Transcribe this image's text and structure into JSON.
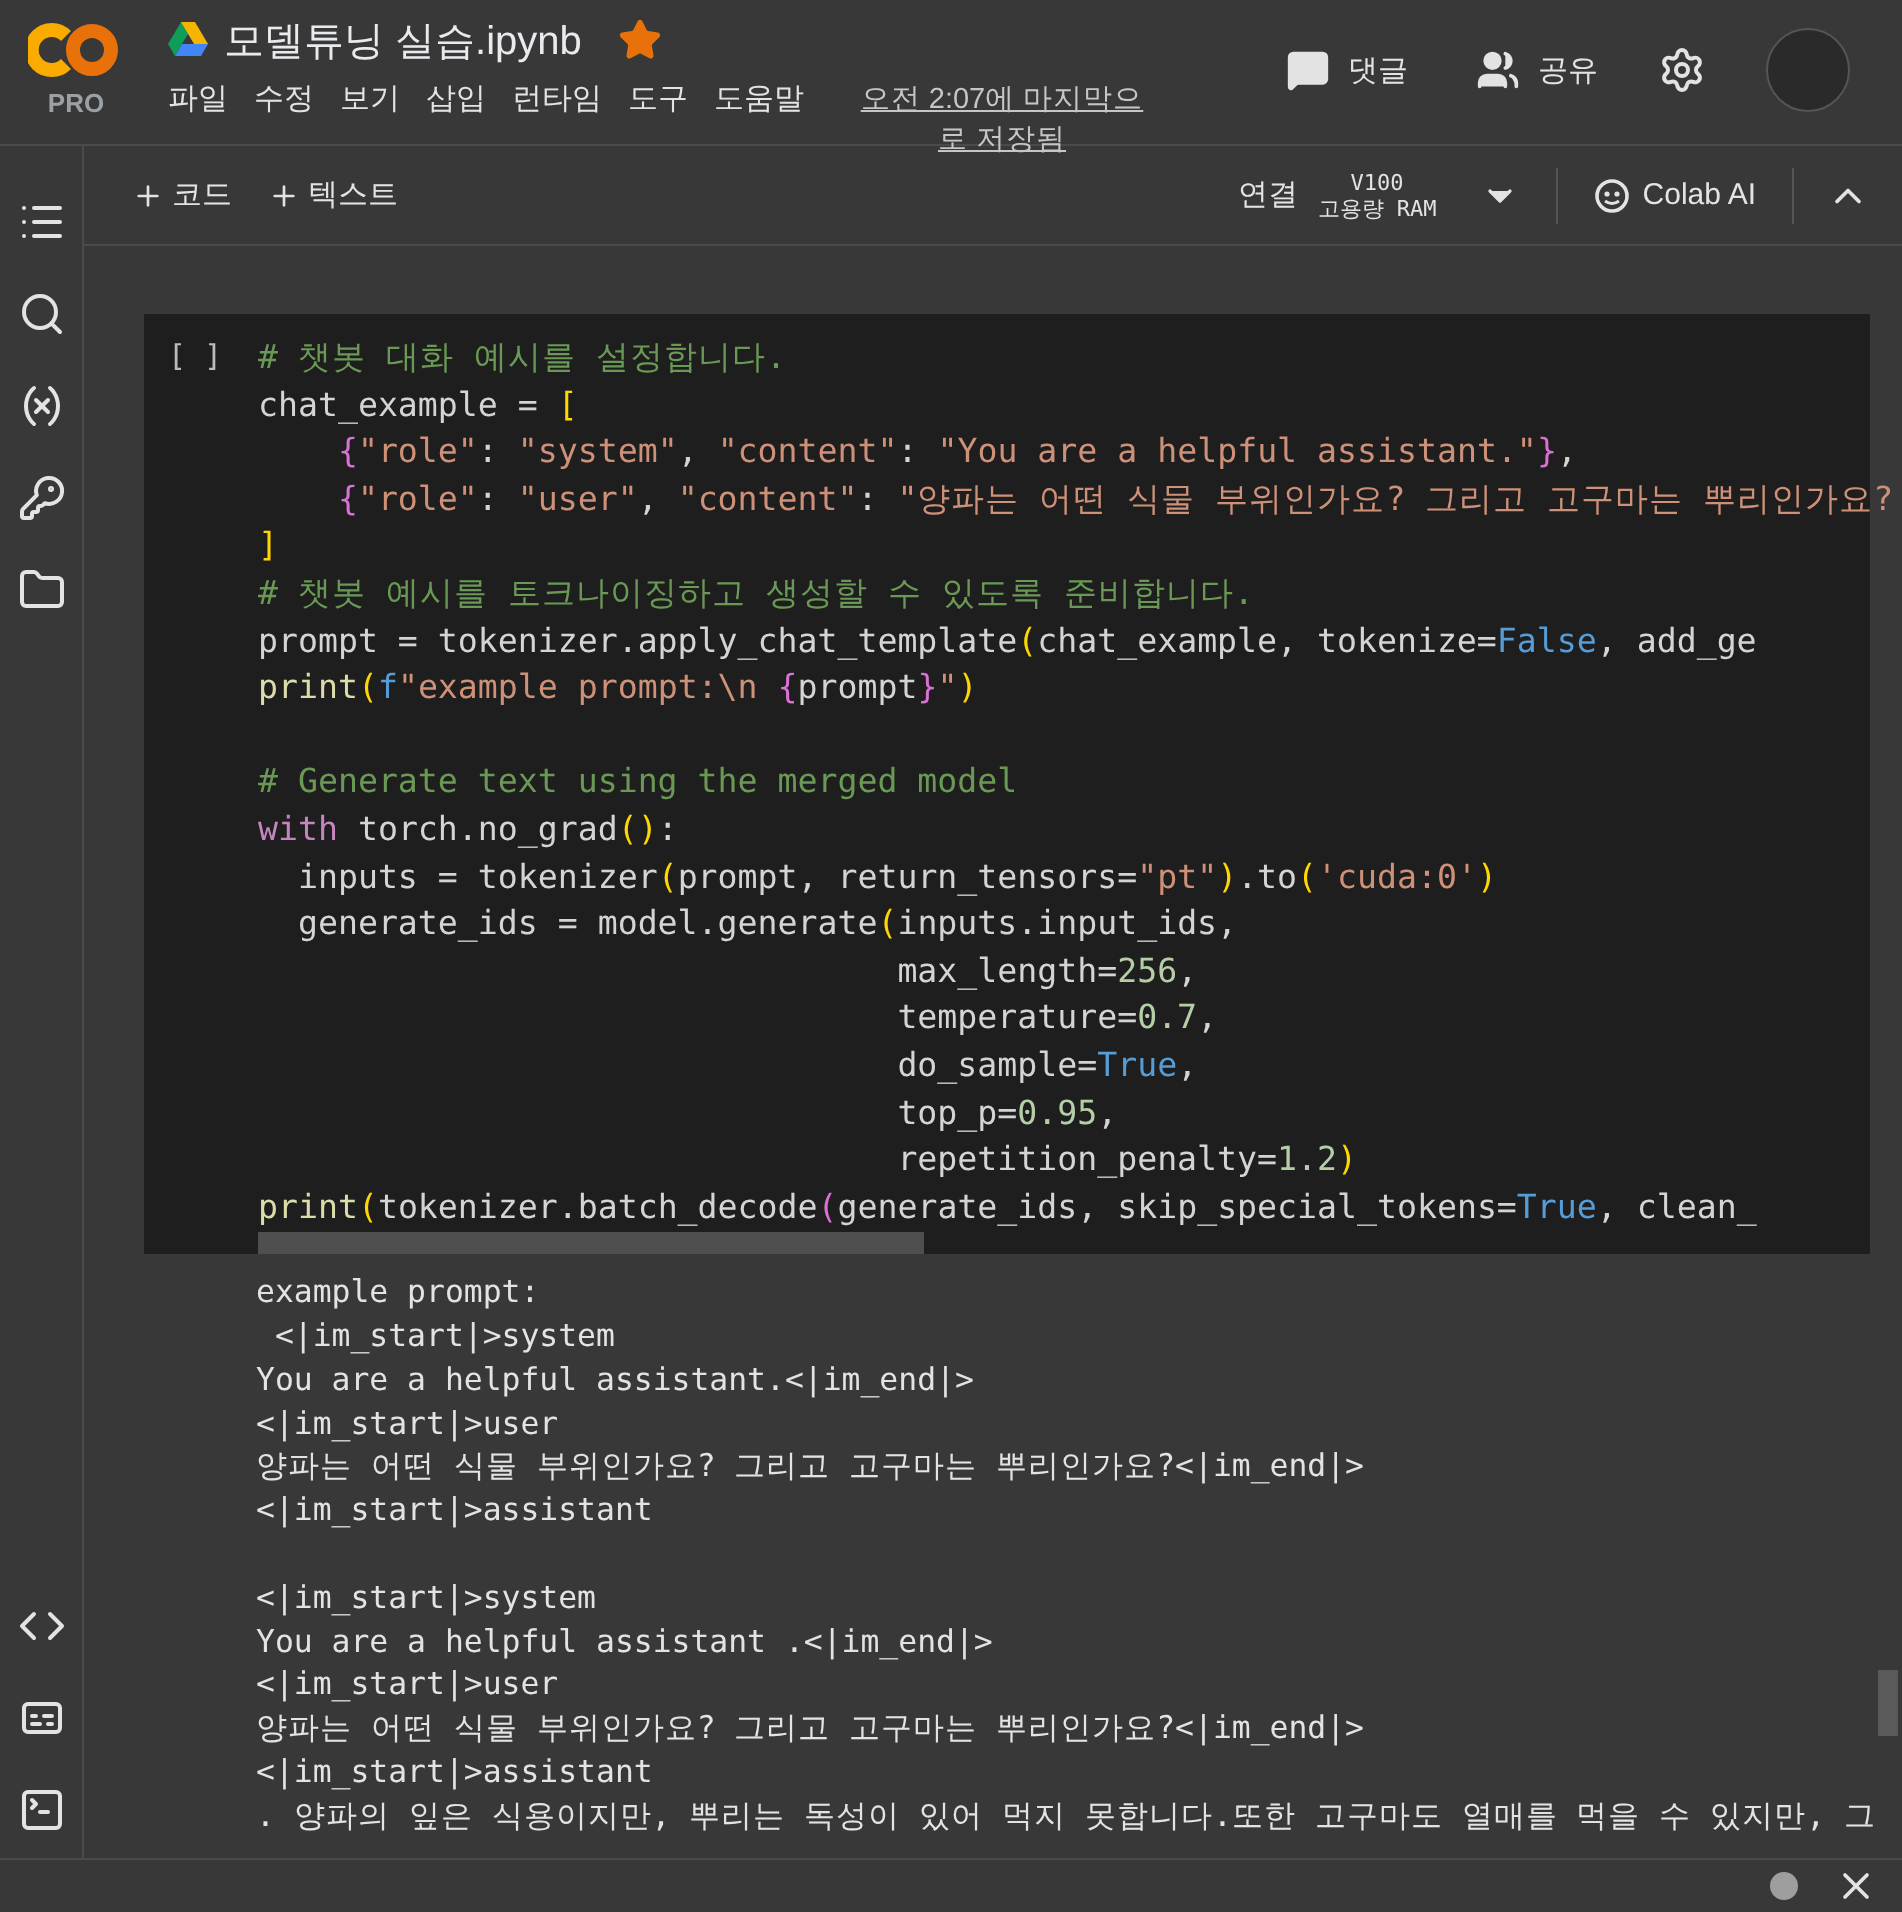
{
  "header": {
    "logo_badge": "PRO",
    "title": "모델튜닝 실습.ipynb",
    "starred": true,
    "menu": [
      "파일",
      "수정",
      "보기",
      "삽입",
      "런타임",
      "도구",
      "도움말"
    ],
    "save_status": "오전 2:07에 마지막으로 저장됨",
    "actions": [
      {
        "kind": "comment",
        "label": "댓글"
      },
      {
        "kind": "share",
        "label": "공유"
      }
    ]
  },
  "toolbar": {
    "add_buttons": [
      {
        "label": "코드"
      },
      {
        "label": "텍스트"
      }
    ],
    "connect": "연결",
    "runtime": [
      "V100",
      "고용량 RAM"
    ],
    "ai": "Colab AI"
  },
  "cell": {
    "exec_label": "[ ]",
    "lines": [
      {
        "kind": "code",
        "tokens": [
          {
            "kind": "cm",
            "t": "# 챗봇 대화 예시를 설정합니다."
          }
        ]
      },
      {
        "kind": "code",
        "tokens": [
          {
            "kind": "p",
            "t": "chat_example = "
          },
          {
            "kind": "b1",
            "t": "["
          }
        ]
      },
      {
        "kind": "code",
        "tokens": [
          {
            "kind": "b2",
            "t": "    {"
          },
          {
            "kind": "str",
            "t": "\"role\""
          },
          {
            "kind": "p",
            "t": ": "
          },
          {
            "kind": "str",
            "t": "\"system\""
          },
          {
            "kind": "p",
            "t": ", "
          },
          {
            "kind": "str",
            "t": "\"content\""
          },
          {
            "kind": "p",
            "t": ": "
          },
          {
            "kind": "str",
            "t": "\"You are a helpful assistant.\""
          },
          {
            "kind": "b2",
            "t": "}"
          },
          {
            "kind": "p",
            "t": ","
          }
        ]
      },
      {
        "kind": "code",
        "tokens": [
          {
            "kind": "b2",
            "t": "    {"
          },
          {
            "kind": "str",
            "t": "\"role\""
          },
          {
            "kind": "p",
            "t": ": "
          },
          {
            "kind": "str",
            "t": "\"user\""
          },
          {
            "kind": "p",
            "t": ", "
          },
          {
            "kind": "str",
            "t": "\"content\""
          },
          {
            "kind": "p",
            "t": ": "
          },
          {
            "kind": "str",
            "t": "\"양파는 어떤 식물 부위인가요? 그리고 고구마는 뿌리인가요?"
          }
        ]
      },
      {
        "kind": "code",
        "tokens": [
          {
            "kind": "b1",
            "t": "]"
          }
        ]
      },
      {
        "kind": "code",
        "tokens": [
          {
            "kind": "cm",
            "t": "# 챗봇 예시를 토크나이징하고 생성할 수 있도록 준비합니다."
          }
        ]
      },
      {
        "kind": "code",
        "tokens": [
          {
            "kind": "p",
            "t": "prompt = tokenizer.apply_chat_template"
          },
          {
            "kind": "b1",
            "t": "("
          },
          {
            "kind": "p",
            "t": "chat_example, tokenize="
          },
          {
            "kind": "const",
            "t": "False"
          },
          {
            "kind": "p",
            "t": ", add_ge"
          }
        ]
      },
      {
        "kind": "code",
        "tokens": [
          {
            "kind": "fn",
            "t": "print"
          },
          {
            "kind": "b1",
            "t": "("
          },
          {
            "kind": "const",
            "t": "f"
          },
          {
            "kind": "str",
            "t": "\"example prompt:\\n "
          },
          {
            "kind": "b2",
            "t": "{"
          },
          {
            "kind": "p",
            "t": "prompt"
          },
          {
            "kind": "b2",
            "t": "}"
          },
          {
            "kind": "str",
            "t": "\""
          },
          {
            "kind": "b1",
            "t": ")"
          }
        ]
      },
      {
        "kind": "blank"
      },
      {
        "kind": "code",
        "tokens": [
          {
            "kind": "cm",
            "t": "# Generate text using the merged model"
          }
        ]
      },
      {
        "kind": "code",
        "tokens": [
          {
            "kind": "kw",
            "t": "with"
          },
          {
            "kind": "p",
            "t": " torch.no_grad"
          },
          {
            "kind": "b1",
            "t": "()"
          },
          {
            "kind": "p",
            "t": ":"
          }
        ]
      },
      {
        "kind": "code",
        "tokens": [
          {
            "kind": "p",
            "t": "  inputs = tokenizer"
          },
          {
            "kind": "b1",
            "t": "("
          },
          {
            "kind": "p",
            "t": "prompt, return_tensors="
          },
          {
            "kind": "str",
            "t": "\"pt\""
          },
          {
            "kind": "b1",
            "t": ")"
          },
          {
            "kind": "p",
            "t": ".to"
          },
          {
            "kind": "b1",
            "t": "("
          },
          {
            "kind": "str",
            "t": "'cuda:0'"
          },
          {
            "kind": "b1",
            "t": ")"
          }
        ]
      },
      {
        "kind": "code",
        "tokens": [
          {
            "kind": "p",
            "t": "  generate_ids = model.generate"
          },
          {
            "kind": "b1",
            "t": "("
          },
          {
            "kind": "p",
            "t": "inputs.input_ids,"
          }
        ]
      },
      {
        "kind": "code",
        "tokens": [
          {
            "kind": "p",
            "t": "                                max_length="
          },
          {
            "kind": "num",
            "t": "256"
          },
          {
            "kind": "p",
            "t": ","
          }
        ]
      },
      {
        "kind": "code",
        "tokens": [
          {
            "kind": "p",
            "t": "                                temperature="
          },
          {
            "kind": "num",
            "t": "0.7"
          },
          {
            "kind": "p",
            "t": ","
          }
        ]
      },
      {
        "kind": "code",
        "tokens": [
          {
            "kind": "p",
            "t": "                                do_sample="
          },
          {
            "kind": "const",
            "t": "True"
          },
          {
            "kind": "p",
            "t": ","
          }
        ]
      },
      {
        "kind": "code",
        "tokens": [
          {
            "kind": "p",
            "t": "                                top_p="
          },
          {
            "kind": "num",
            "t": "0.95"
          },
          {
            "kind": "p",
            "t": ","
          }
        ]
      },
      {
        "kind": "code",
        "tokens": [
          {
            "kind": "p",
            "t": "                                repetition_penalty="
          },
          {
            "kind": "num",
            "t": "1.2"
          },
          {
            "kind": "b1",
            "t": ")"
          }
        ]
      },
      {
        "kind": "code",
        "tokens": [
          {
            "kind": "fn",
            "t": "print"
          },
          {
            "kind": "b1",
            "t": "("
          },
          {
            "kind": "p",
            "t": "tokenizer.batch_decode"
          },
          {
            "kind": "b2",
            "t": "("
          },
          {
            "kind": "p",
            "t": "generate_ids, skip_special_tokens="
          },
          {
            "kind": "const",
            "t": "True"
          },
          {
            "kind": "p",
            "t": ", clean_"
          }
        ]
      }
    ],
    "output": [
      [
        "example prompt:",
        " <|im_start|>system",
        "You are a helpful assistant.<|im_end|>",
        "<|im_start|>user",
        "양파는 어떤 식물 부위인가요? 그리고 고구마는 뿌리인가요?<|im_end|>",
        "<|im_start|>assistant"
      ],
      [
        "<|im_start|>system",
        "You are a helpful assistant .<|im_end|>",
        "<|im_start|>user",
        "양파는 어떤 식물 부위인가요? 그리고 고구마는 뿌리인가요?<|im_end|>",
        "<|im_start|>assistant",
        ". 양파의 잎은 식용이지만, 뿌리는 독성이 있어 먹지 못합니다.또한 고구마도 열매를 먹을 수 있지만, 그"
      ]
    ]
  }
}
